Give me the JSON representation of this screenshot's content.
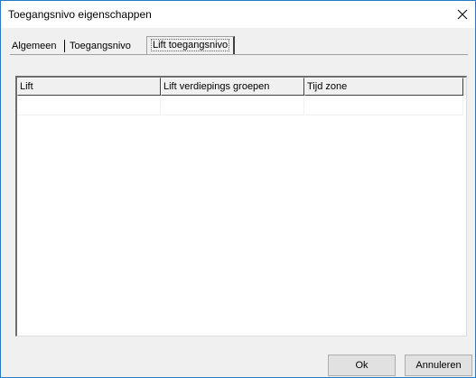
{
  "window": {
    "title": "Toegangsnivo eigenschappen"
  },
  "tabs": [
    {
      "label": "Algemeen",
      "active": false
    },
    {
      "label": "Toegangsnivo",
      "active": false
    },
    {
      "label": "Lift toegangsnivo",
      "active": true
    }
  ],
  "listview": {
    "columns": [
      "Lift",
      "Lift verdiepings groepen",
      "Tijd zone"
    ],
    "rows": [
      [
        "",
        "",
        ""
      ]
    ]
  },
  "buttons": {
    "ok_label": "Ok",
    "cancel_label": "Annuleren"
  },
  "colors": {
    "window_border": "#2b78c9",
    "dialog_background": "#f0f0f0",
    "list_background": "#ffffff"
  },
  "icons": {
    "close": "close-icon"
  }
}
